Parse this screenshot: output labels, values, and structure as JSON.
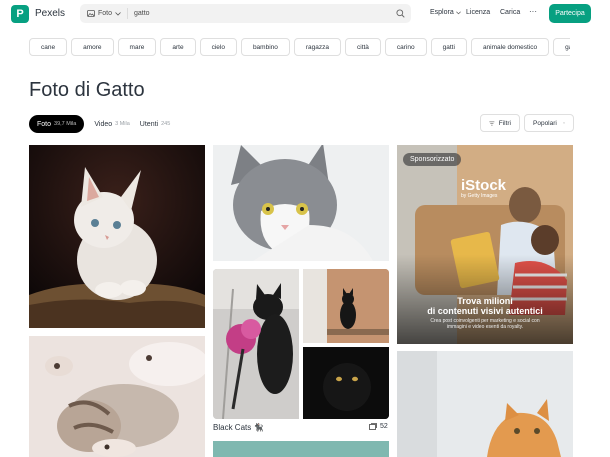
{
  "header": {
    "logo_letter": "P",
    "brand": "Pexels",
    "search_category": "Foto",
    "search_value": "gatto",
    "nav": {
      "explore": "Esplora",
      "license": "Licenza",
      "upload": "Carica",
      "more": "···",
      "join": "Partecipa"
    }
  },
  "chips": [
    "cane",
    "amore",
    "mare",
    "arte",
    "cielo",
    "bambino",
    "ragazza",
    "città",
    "carino",
    "gatti",
    "animale domestico",
    "gattino"
  ],
  "page_title": "Foto di Gatto",
  "tabs": [
    {
      "label": "Foto",
      "count": "39,7 Mila",
      "active": true
    },
    {
      "label": "Video",
      "count": "3 Mila",
      "active": false
    },
    {
      "label": "Utenti",
      "count": "245",
      "active": false
    }
  ],
  "filters_label": "Filtri",
  "sort_label": "Popolari",
  "ad": {
    "badge": "Sponsorizzato",
    "brand": "iStock",
    "brand_sub": "by Getty Images",
    "headline_line1": "Trova milioni",
    "headline_line2": "di contenuti visivi autentici",
    "sub": "Crea post coinvolgenti per marketing e social con immagini e video esenti da royalty."
  },
  "collection": {
    "caption": "Black Cats 🐈‍⬛",
    "count": "52"
  },
  "colors": {
    "brand": "#07a081",
    "text": "#2c343e"
  },
  "icons": {
    "logo": "pexels-logo-icon",
    "photo": "photo-icon",
    "chevron": "chevron-down-icon",
    "search": "search-icon",
    "filter": "filter-icon",
    "collection": "collection-icon"
  }
}
